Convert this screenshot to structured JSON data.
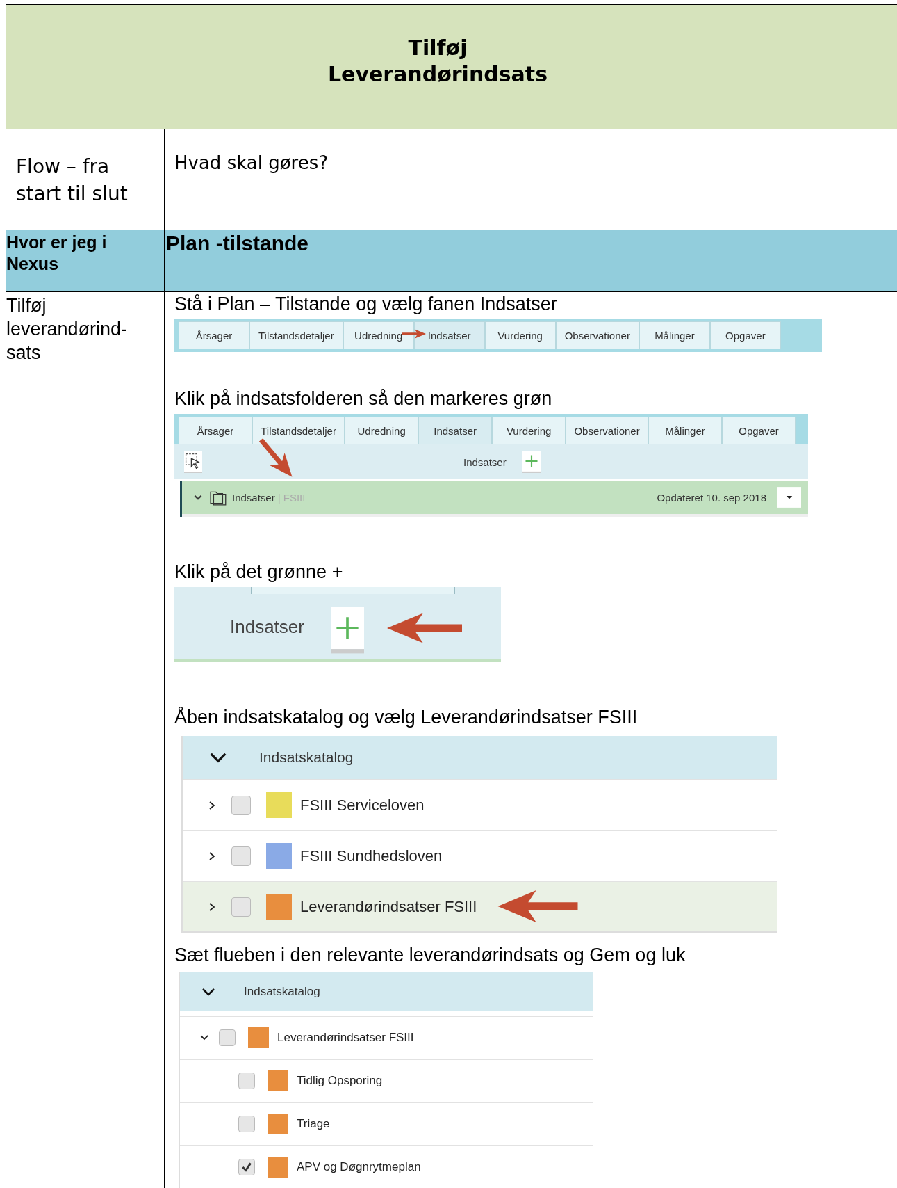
{
  "title": "Tilføj Leverandørindsats",
  "flow_label": "Flow – fra start til slut",
  "question": "Hvad skal gøres?",
  "location_label": "Hvor er jeg i Nexus",
  "location": "Plan -tilstande",
  "task": "Tilføj leverandørind-sats",
  "steps": [
    {
      "kind": "tabs",
      "instruction": "Stå i Plan – Tilstande og vælg fanen Indsatser",
      "tabs": [
        {
          "label": "Årsager",
          "selected": false
        },
        {
          "label": "Tilstandsdetaljer",
          "selected": false
        },
        {
          "label": "Udredning",
          "selected": false
        },
        {
          "label": "Indsatser",
          "selected": true
        },
        {
          "label": "Vurdering",
          "selected": false
        },
        {
          "label": "Observationer",
          "selected": false
        },
        {
          "label": "Målinger",
          "selected": false
        },
        {
          "label": "Opgaver",
          "selected": false
        }
      ]
    },
    {
      "kind": "folder",
      "instruction": "Klik på indsatsfolderen så den markeres grøn",
      "tabs": [
        {
          "label": "Årsager",
          "selected": false
        },
        {
          "label": "Tilstandsdetaljer",
          "selected": false
        },
        {
          "label": "Udredning",
          "selected": false
        },
        {
          "label": "Indsatser",
          "selected": true
        },
        {
          "label": "Vurdering",
          "selected": false
        },
        {
          "label": "Observationer",
          "selected": false
        },
        {
          "label": "Målinger",
          "selected": false
        },
        {
          "label": "Opgaver",
          "selected": false
        }
      ],
      "toolbar_label": "Indsatser",
      "folder": {
        "name": "Indsatser",
        "tag": "| FSIII",
        "updated": "Opdateret 10. sep 2018",
        "selected": true
      }
    },
    {
      "kind": "add",
      "instruction": "Klik på det grønne +",
      "label": "Indsatser"
    },
    {
      "kind": "catalog",
      "instruction": "Åben indsatskatalog og vælg Leverandørindsatser FSIII",
      "header": "Indsatskatalog",
      "items": [
        {
          "name": "FSIII Serviceloven",
          "color": "#e8dc5a",
          "checked": false,
          "expanded": false,
          "selected": false
        },
        {
          "name": "FSIII Sundhedsloven",
          "color": "#8aaae6",
          "checked": false,
          "expanded": false,
          "selected": false
        },
        {
          "name": "Leverandørindsatser FSIII",
          "color": "#e88e3e",
          "checked": false,
          "expanded": false,
          "selected": true
        }
      ]
    },
    {
      "kind": "tree",
      "instruction": "Sæt flueben i den relevante leverandørindsats og Gem og luk",
      "header": "Indsatskatalog",
      "items": [
        {
          "name": "Leverandørindsatser FSIII",
          "color": "#e88e3e",
          "checked": false,
          "expanded": true,
          "selected": false,
          "children": [
            {
              "name": "Tidlig Opsporing",
              "color": "#e88e3e",
              "checked": false
            },
            {
              "name": "Triage",
              "color": "#e88e3e",
              "checked": false
            },
            {
              "name": "APV og Døgnrytmeplan",
              "color": "#e88e3e",
              "checked": true
            }
          ]
        }
      ]
    }
  ]
}
